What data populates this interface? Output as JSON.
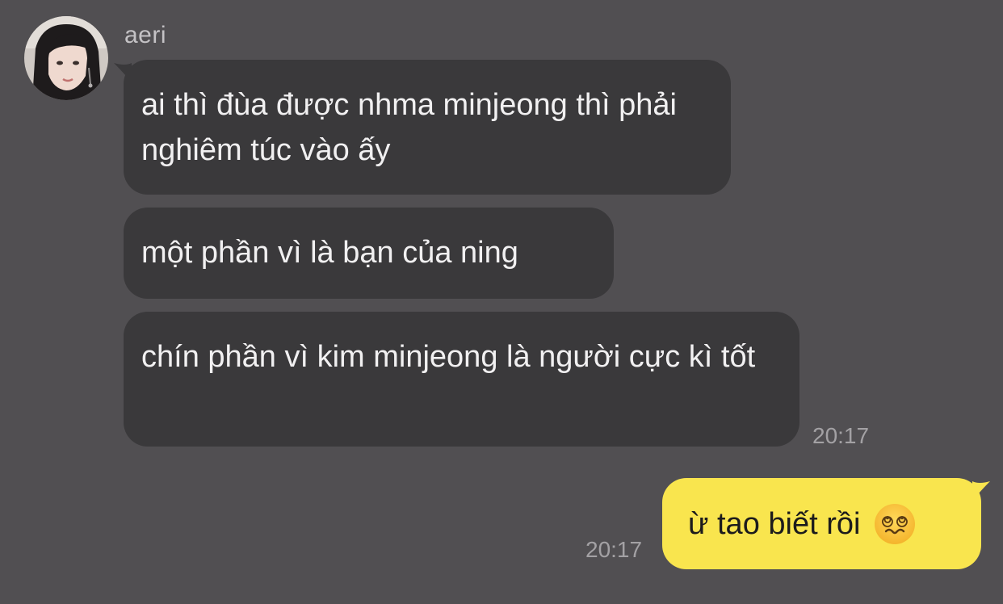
{
  "contact": {
    "name": "aeri",
    "avatar_icon": "profile-photo"
  },
  "messages_in": [
    {
      "text": "ai thì đùa được nhma minjeong thì phải nghiêm túc vào ấy"
    },
    {
      "text": "một phần vì là bạn của ning"
    },
    {
      "text": "chín phần vì kim minjeong là người cực kì tốt"
    }
  ],
  "time_in": "20:17",
  "message_out": {
    "text": "ừ tao biết rồi",
    "emoji": "dizzy-face-emoji"
  },
  "time_out": "20:17",
  "colors": {
    "background": "#514f52",
    "incoming_bubble": "#3a393b",
    "outgoing_bubble": "#f9e54e"
  }
}
